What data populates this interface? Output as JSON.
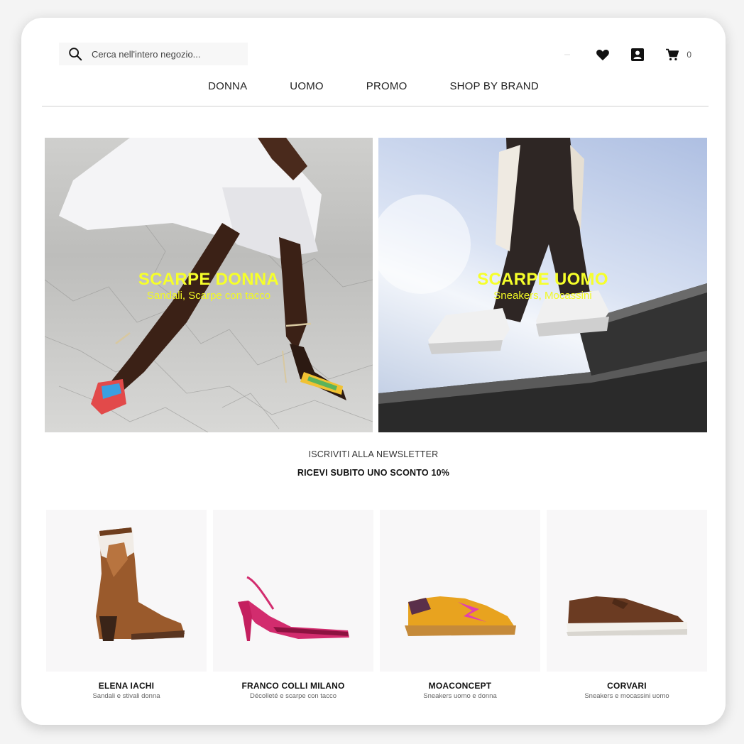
{
  "header": {
    "search_placeholder": "Cerca nell'intero negozio...",
    "cart_count": "0",
    "flag_colors": [
      "#009246",
      "#ffffff",
      "#ce2b37"
    ]
  },
  "nav": {
    "items": [
      "DONNA",
      "UOMO",
      "PROMO",
      "SHOP BY BRAND"
    ]
  },
  "banners": {
    "women": {
      "title": "SCARPE DONNA",
      "subtitle": "Sandali, Scarpe con tacco"
    },
    "men": {
      "title": "SCARPE UOMO",
      "subtitle": "Sneakers, Mocassini"
    }
  },
  "newsletter": {
    "title": "ISCRIVITI ALLA NEWSLETTER",
    "subtitle": "RICEVI SUBITO UNO SCONTO 10%"
  },
  "brands": [
    {
      "name": "ELENA IACHI",
      "desc": "Sandali e stivali donna"
    },
    {
      "name": "FRANCO COLLI MILANO",
      "desc": "Décolleté e scarpe con tacco"
    },
    {
      "name": "MOACONCEPT",
      "desc": "Sneakers uomo e donna"
    },
    {
      "name": "CORVARI",
      "desc": "Sneakers e mocassini uomo"
    }
  ],
  "colors": {
    "banner_text": "#f6ff2a",
    "text_dark": "#111111"
  }
}
